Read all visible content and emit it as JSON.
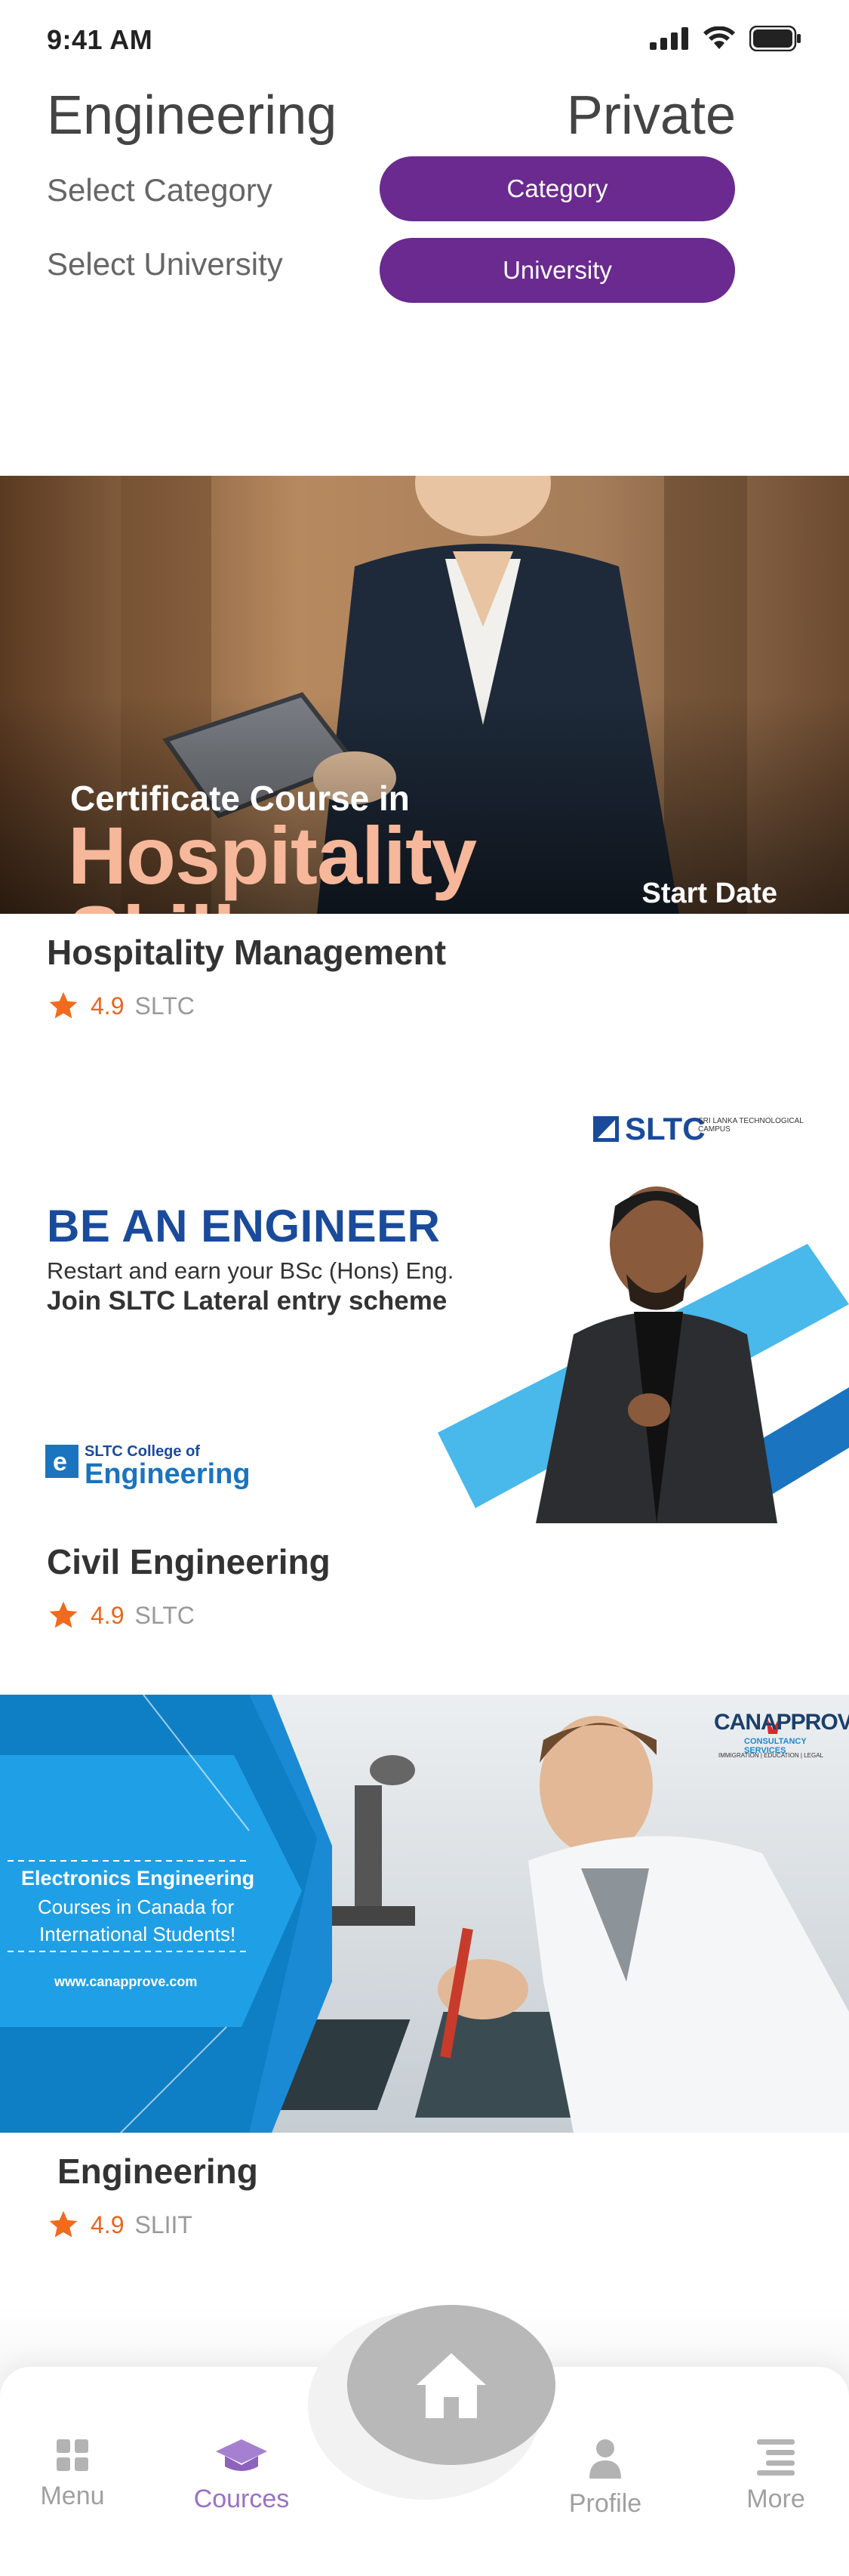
{
  "status": {
    "time": "9:41 AM"
  },
  "header": {
    "title": "Engineering",
    "type": "Private"
  },
  "filters": {
    "category_label": "Select Category",
    "category_button": "Category",
    "university_label": "Select University",
    "university_button": "University"
  },
  "courses": [
    {
      "title": "Hospitality Management",
      "rating": "4.9",
      "university": "SLTC",
      "banner": {
        "line1": "Certificate Course in",
        "line2": "Hospitality",
        "line3": "Skill",
        "corner": "Start Date"
      }
    },
    {
      "title": "Civil Engineering",
      "rating": "4.9",
      "university": "SLTC",
      "banner": {
        "brand": "SLTC",
        "brand_sub": "SRI LANKA TECHNOLOGICAL CAMPUS",
        "headline": "BE AN ENGINEER",
        "sub1": "Restart and earn your BSc (Hons) Eng.",
        "sub2": "Join SLTC Lateral entry scheme",
        "college_small": "SLTC College of",
        "college_big": "Engineering"
      }
    },
    {
      "title": "Engineering",
      "rating": "4.9",
      "university": "SLIIT",
      "banner": {
        "line1": "Electronics Engineering",
        "line2": "Courses in Canada for",
        "line3": "International Students!",
        "url": "www.canapprove.com",
        "brand": "CANAPPROVE",
        "brand_sub": "CONSULTANCY SERVICES",
        "brand_tag": "IMMIGRATION | EDUCATION | LEGAL"
      }
    }
  ],
  "nav": {
    "menu": "Menu",
    "courses": "Cources",
    "profile": "Profile",
    "more": "More"
  },
  "colors": {
    "accent": "#6a2a8f",
    "rating": "#e8671f",
    "active_nav": "#9b6fc7"
  }
}
